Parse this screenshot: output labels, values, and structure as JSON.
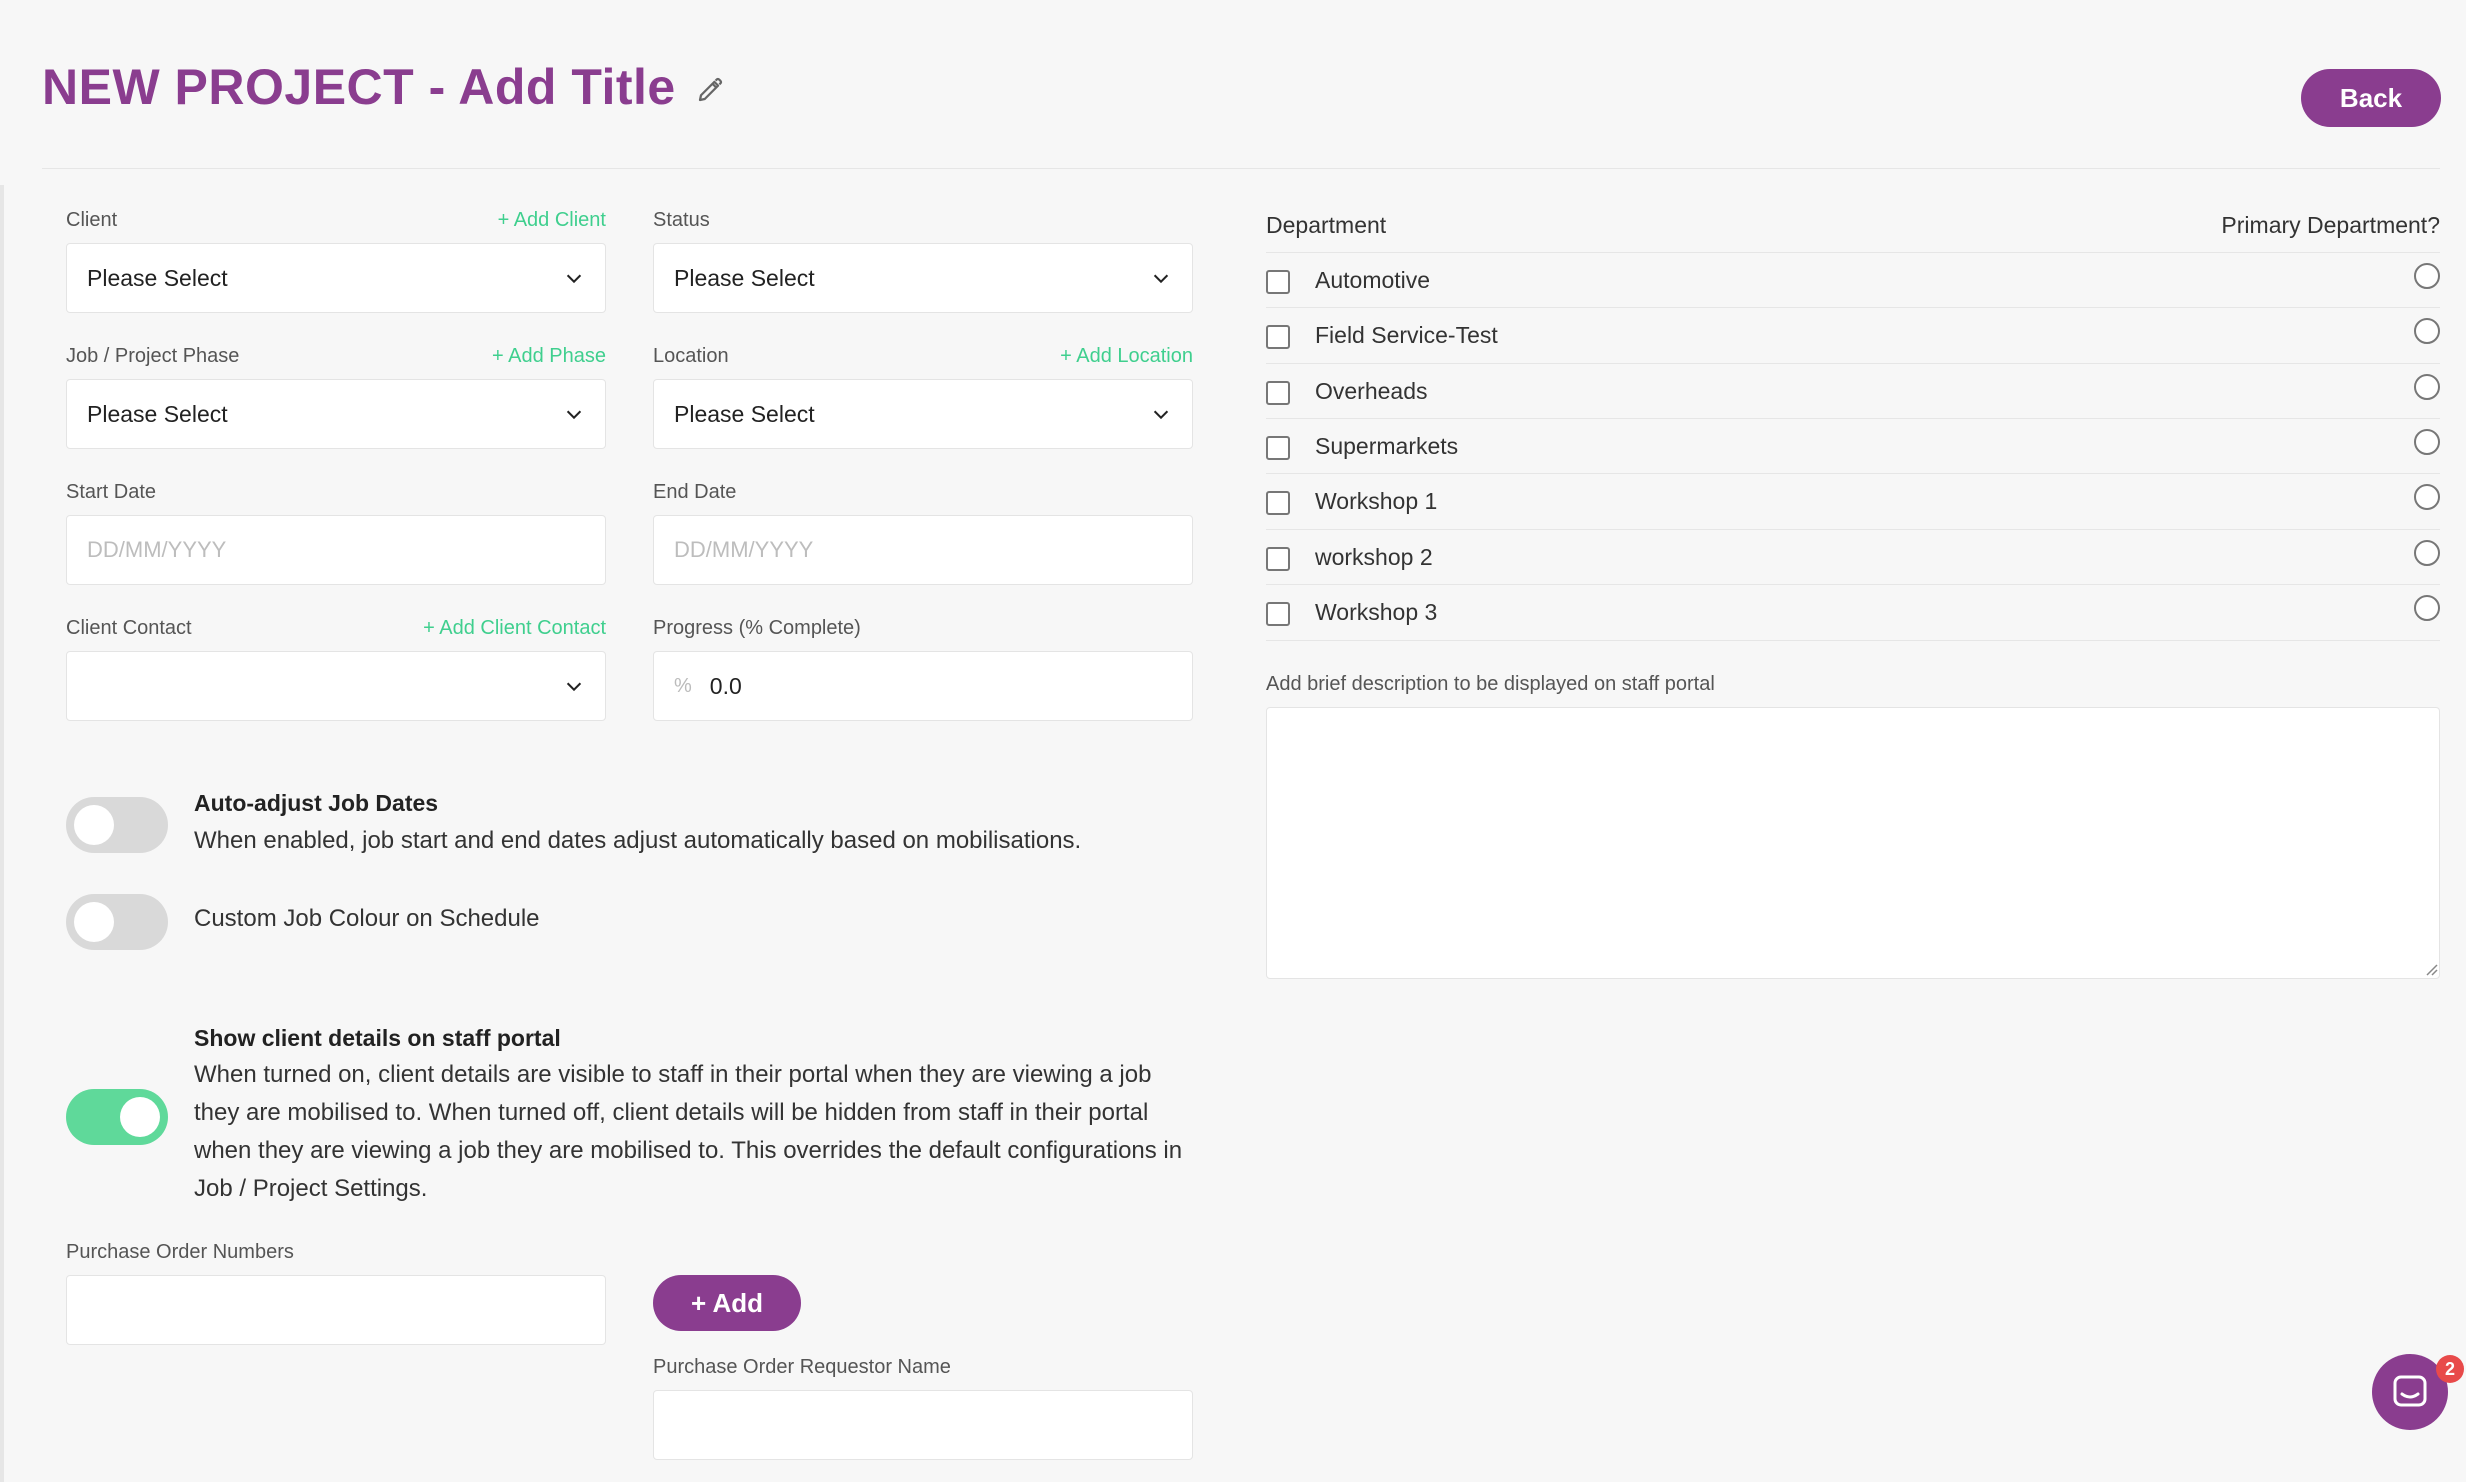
{
  "header": {
    "title": "NEW PROJECT - Add Title",
    "back_label": "Back",
    "edit_icon": "pencil-icon"
  },
  "form": {
    "client": {
      "label": "Client",
      "add_link": "+ Add Client",
      "value": "Please Select"
    },
    "status": {
      "label": "Status",
      "value": "Please Select"
    },
    "phase": {
      "label": "Job / Project Phase",
      "add_link": "+ Add Phase",
      "value": "Please Select"
    },
    "location": {
      "label": "Location",
      "add_link": "+ Add Location",
      "value": "Please Select"
    },
    "start_date": {
      "label": "Start Date",
      "placeholder": "DD/MM/YYYY"
    },
    "end_date": {
      "label": "End Date",
      "placeholder": "DD/MM/YYYY"
    },
    "client_contact": {
      "label": "Client Contact",
      "add_link": "+ Add Client Contact",
      "value": ""
    },
    "progress": {
      "label": "Progress (% Complete)",
      "value": "0.0",
      "icon": "%"
    }
  },
  "toggles": {
    "auto_adjust": {
      "title": "Auto-adjust Job Dates",
      "text": "When enabled, job start and end dates adjust automatically based on mobilisations.",
      "on": false
    },
    "custom_colour": {
      "title": "Custom Job Colour on Schedule",
      "on": false
    },
    "show_client": {
      "title": "Show client details on staff portal",
      "text": "When turned on, client details are visible to staff in their portal when they are viewing a job they are mobilised to. When turned off, client details will be hidden from staff in their portal when they are viewing a job they are mobilised to. This overrides the default configurations in Job / Project Settings.",
      "on": true
    }
  },
  "purchase_order": {
    "numbers_label": "Purchase Order Numbers",
    "add_label": "+ Add",
    "requestor_label": "Purchase Order Requestor Name"
  },
  "departments": {
    "heading": "Department",
    "primary_heading": "Primary Department?",
    "items": [
      {
        "name": "Automotive",
        "checked": false,
        "primary": false
      },
      {
        "name": "Field Service-Test",
        "checked": false,
        "primary": false
      },
      {
        "name": "Overheads",
        "checked": false,
        "primary": false
      },
      {
        "name": "Supermarkets",
        "checked": false,
        "primary": false
      },
      {
        "name": "Workshop 1",
        "checked": false,
        "primary": false
      },
      {
        "name": "workshop 2",
        "checked": false,
        "primary": false
      },
      {
        "name": "Workshop 3",
        "checked": false,
        "primary": false
      }
    ]
  },
  "description": {
    "label": "Add brief description to be displayed on staff portal",
    "value": ""
  },
  "chat": {
    "icon": "chat-icon",
    "badge": "2"
  },
  "colors": {
    "accent": "#8a3d8f",
    "link": "#3fcf8e",
    "toggle_on": "#5fd99a",
    "badge": "#e84a4a"
  }
}
